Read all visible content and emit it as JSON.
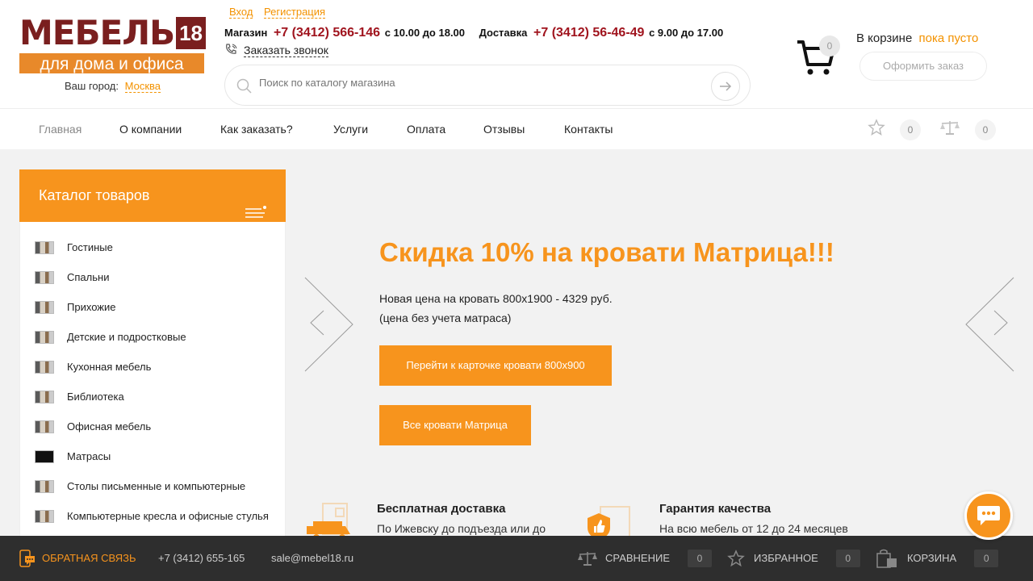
{
  "header": {
    "logo_word": "МЕБЕЛЬ",
    "logo_num": "18",
    "logo_sub": "для дома и офиса",
    "city_label": "Ваш город:",
    "city_value": "Москва",
    "login": "Вход",
    "register": "Регистрация",
    "shop_label": "Магазин",
    "shop_phone": "+7 (3412) 566-146",
    "shop_hours": "с 10.00 до 18.00",
    "delivery_label": "Доставка",
    "delivery_phone": "+7 (3412) 56-46-49",
    "delivery_hours": "с 9.00 до 17.00",
    "callback": "Заказать звонок",
    "search_placeholder": "Поиск по каталогу магазина",
    "cart_count": "0",
    "cart_label": "В корзине",
    "cart_state": "пока пусто",
    "order_button": "Оформить заказ"
  },
  "nav": {
    "items": [
      "Главная",
      "О компании",
      "Как заказать?",
      "Услуги",
      "Оплата",
      "Отзывы",
      "Контакты"
    ],
    "favorites_count": "0",
    "compare_count": "0"
  },
  "catalog": {
    "title": "Каталог товаров",
    "items": [
      "Гостиные",
      "Спальни",
      "Прихожие",
      "Детские и подростковые",
      "Кухонная мебель",
      "Библиотека",
      "Офисная мебель",
      "Матрасы",
      "Столы письменные и компьютерные",
      "Компьютерные кресла и офисные стулья"
    ]
  },
  "slide": {
    "title": "Скидка 10% на кровати Матрица!!!",
    "line1": "Новая цена на кровать 800х1900 - 4329 руб.",
    "line2": "(цена без учета матраса)",
    "button1": "Перейти к карточке кровати 800х900",
    "button2": "Все кровати Матрица"
  },
  "features": [
    {
      "title": "Бесплатная доставка",
      "text": "По Ижевску до подъезда или до"
    },
    {
      "title": "Гарантия качества",
      "text": "На всю мебель от 12 до 24 месяцев"
    }
  ],
  "bottombar": {
    "feedback": "ОБРАТНАЯ СВЯЗЬ",
    "phone": "+7 (3412) 655-165",
    "email": "sale@mebel18.ru",
    "compare": "СРАВНЕНИЕ",
    "compare_count": "0",
    "favorites": "ИЗБРАННОЕ",
    "favorites_count": "0",
    "cart": "КОРЗИНА",
    "cart_count": "0"
  },
  "colors": {
    "accent": "#f7941d",
    "brand": "#7a1f1f",
    "phone": "#a0141e",
    "bottombar": "#2e2e2e"
  }
}
